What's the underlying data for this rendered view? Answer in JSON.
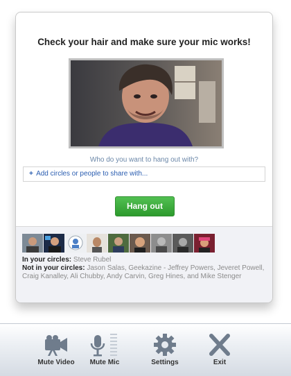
{
  "dialog": {
    "title": "Check your hair and make sure your mic works!",
    "prompt": "Who do you want to hang out with?",
    "share_placeholder_plus": "+",
    "share_placeholder": "Add circles or people to share with...",
    "hangout_button": "Hang out"
  },
  "circles": {
    "in_label": "In your circles:",
    "in_people": "Steve Rubel",
    "not_in_label": "Not in your circles:",
    "not_in_people": "Jason Salas, Geekazine - Jeffrey Powers, Jeveret Powell, Craig Kanalley, Ali Chubby, Andy Carvin, Greg Hines, and Mike Stenger",
    "avatar_count": 9
  },
  "toolbar": {
    "mute_video": "Mute Video",
    "mute_mic": "Mute Mic",
    "settings": "Settings",
    "exit": "Exit"
  },
  "colors": {
    "hangout_green": "#3aa83a",
    "link_blue": "#2a5db0",
    "prompt_blue": "#6b87a8",
    "icon_gray": "#6f7c8c"
  }
}
